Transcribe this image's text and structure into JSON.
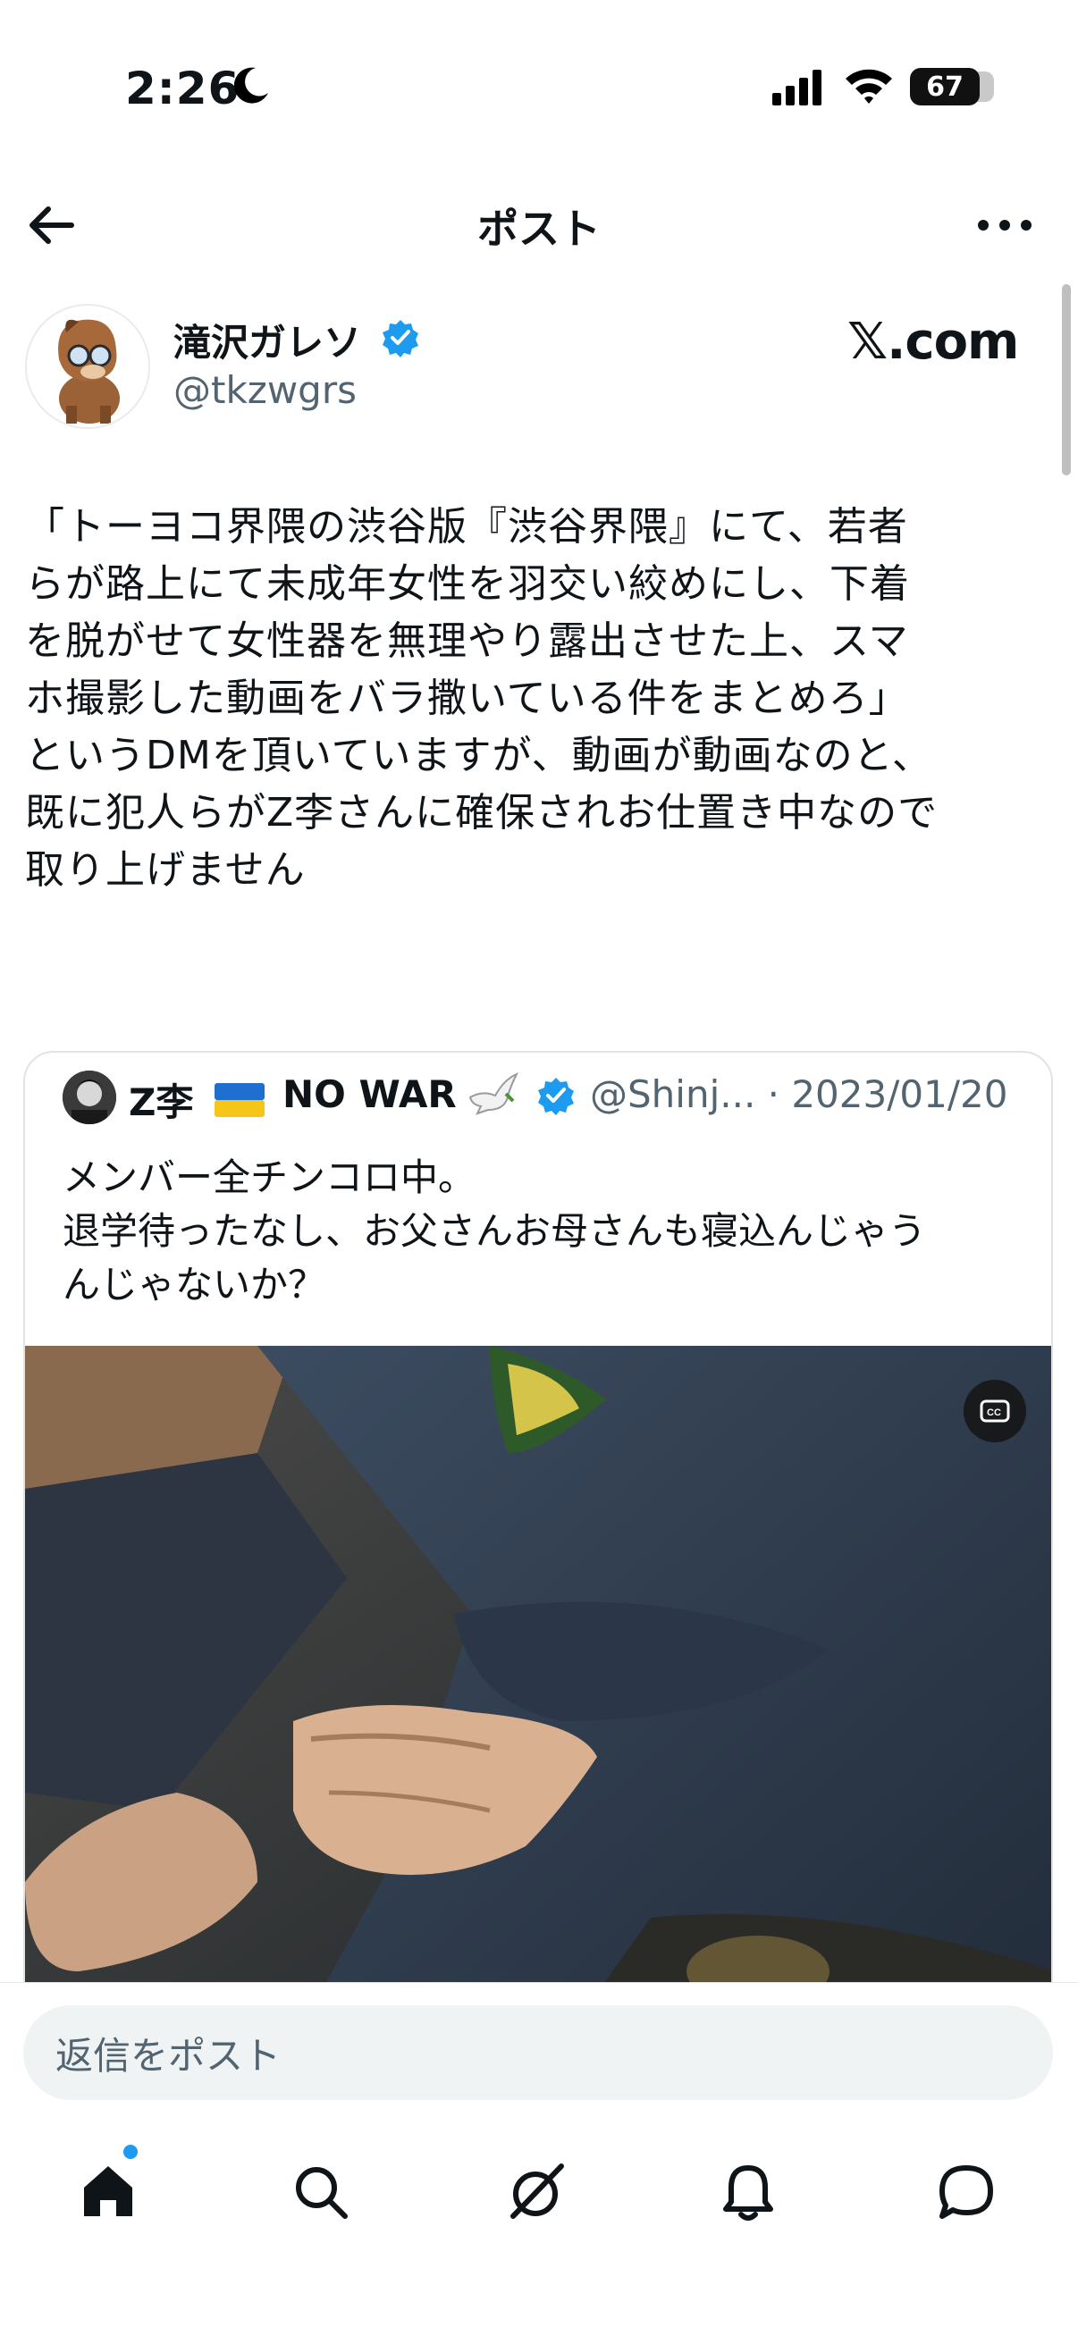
{
  "status_bar": {
    "time": "2:26",
    "battery": "67"
  },
  "header": {
    "title": "ポスト"
  },
  "author": {
    "name": "滝沢ガレソ",
    "handle": "@tkzwgrs",
    "watermark": "𝕏.com"
  },
  "post": {
    "text": "「トーヨコ界隈の渋谷版『渋谷界隈』にて、若者\nらが路上にて未成年女性を羽交い絞めにし、下着\nを脱がせて女性器を無理やり露出させた上、スマ\nホ撮影した動画をバラ撒いている件をまとめろ」\nというDMを頂いていますが、動画が動画なのと、\n既に犯人らがZ李さんに確保されお仕置き中なので\n取り上げません"
  },
  "quote": {
    "name": "Z李",
    "war_label": "NO WAR",
    "handle_date": "@Shinj... · 2023/01/20",
    "text": "メンバー全チンコロ中。\n退学待ったなし、お父さんお母さんも寝込んじゃう\nんじゃないか？"
  },
  "reply": {
    "placeholder": "返信をポスト"
  },
  "tabs": [
    "home-icon",
    "search-icon",
    "grok-icon",
    "bell-icon",
    "messages-icon"
  ],
  "colors": {
    "accent": "#1d9bf0",
    "secondary_text": "#536471"
  }
}
